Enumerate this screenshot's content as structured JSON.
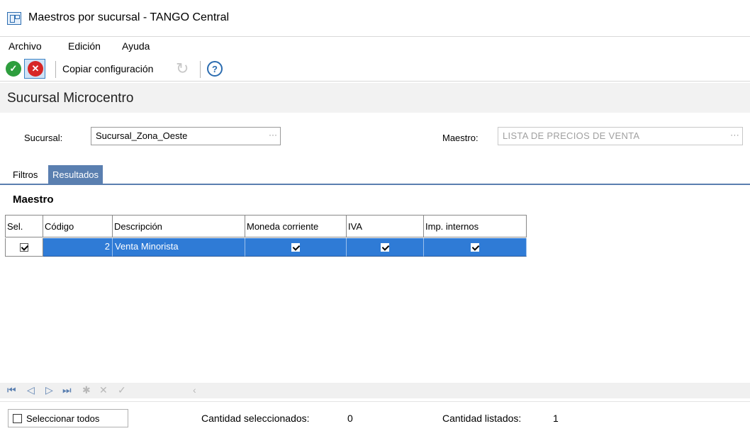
{
  "window": {
    "title": "Maestros por sucursal - TANGO Central"
  },
  "menu": {
    "archivo": "Archivo",
    "edicion": "Edición",
    "ayuda": "Ayuda"
  },
  "toolbar": {
    "copy_label": "Copiar configuración"
  },
  "header": {
    "title": "Sucursal Microcentro"
  },
  "fields": {
    "sucursal_label": "Sucursal:",
    "sucursal_value": "Sucursal_Zona_Oeste",
    "maestro_label": "Maestro:",
    "maestro_value": "LISTA DE PRECIOS DE VENTA"
  },
  "tabs": {
    "filtros": "Filtros",
    "resultados": "Resultados"
  },
  "section": {
    "title": "Maestro"
  },
  "grid": {
    "columns": [
      "Sel.",
      "Código",
      "Descripción",
      "Moneda corriente",
      "IVA",
      "Imp. internos"
    ],
    "rows": [
      {
        "sel": true,
        "codigo": "2",
        "descripcion": "Venta Minorista",
        "moneda_corriente": true,
        "iva": true,
        "imp_internos": true
      }
    ]
  },
  "footer": {
    "select_all": "Seleccionar todos",
    "selected_label": "Cantidad seleccionados:",
    "selected_value": "0",
    "listed_label": "Cantidad listados:",
    "listed_value": "1"
  },
  "colors": {
    "selection": "#2f7bd6",
    "tab_active": "#5a7fb0"
  }
}
